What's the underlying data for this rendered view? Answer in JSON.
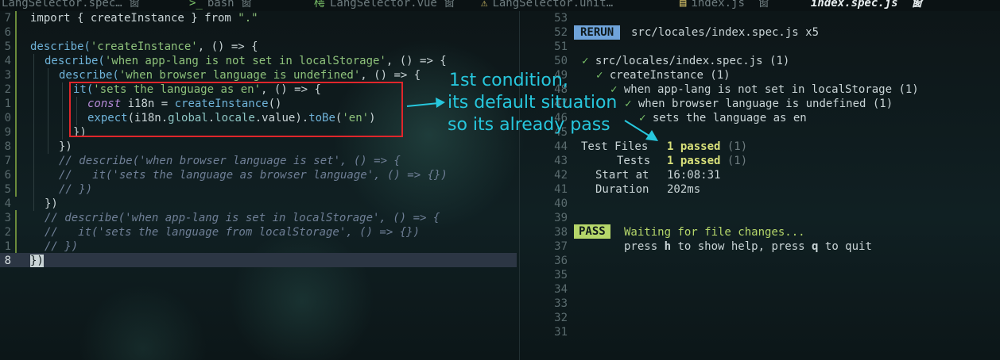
{
  "tabs": [
    {
      "icon": "",
      "label": "LangSelector.spec…",
      "tail": " 窗"
    },
    {
      "icon": ">_",
      "label": "bash",
      "tail": " 窗"
    },
    {
      "icon": "樗",
      "label": "LangSelector.vue",
      "tail": " 窗"
    },
    {
      "icon": "⚠",
      "label": "LangSelector.unit…",
      "tail": ""
    },
    {
      "icon": "▤",
      "label": "index.js",
      "tail": "  窗"
    },
    {
      "icon": "",
      "label": "index.spec.js",
      "tail": "  窗"
    }
  ],
  "editor": {
    "gutter": [
      "7",
      "6",
      "5",
      "4",
      "3",
      "2",
      "1",
      "0",
      "9",
      "8",
      "7",
      "6",
      "5",
      "4",
      "3",
      "2",
      "1",
      "8"
    ],
    "line1": {
      "a": "import { createInstance } from ",
      "b": "\".\""
    },
    "line3": {
      "a": "describe(",
      "b": "'createInstance'",
      "c": ", () => {"
    },
    "line4": {
      "a": "describe(",
      "b": "'when app-lang is not set in localStorage'",
      "c": ", () => {"
    },
    "line5": {
      "a": "describe(",
      "b": "'when browser language is undefined'",
      "c": ", () => {"
    },
    "line6": {
      "a": "it(",
      "b": "'sets the language as en'",
      "c": ", () => {"
    },
    "line7": {
      "a": "const",
      "b": " i18n = ",
      "c": "createInstance",
      "d": "()"
    },
    "line8": {
      "a": "expect",
      "b": "(i18n.",
      "c": "global",
      "d": ".",
      "e": "locale",
      "f": ".value).",
      "g": "toBe",
      "h": "(",
      "i": "'en'",
      "j": ")"
    },
    "line9": "})",
    "line10": "})",
    "line11": "// describe('when browser language is set', () => {",
    "line12": "//   it('sets the language as browser language', () => {})",
    "line13": "// })",
    "line14": "})",
    "line15": "// describe('when app-lang is set in localStorage', () => {",
    "line16": "//   it('sets the language from localStorage', () => {})",
    "line17": "// })",
    "line18": "})"
  },
  "terminal": {
    "gutter": [
      "53",
      "52",
      "51",
      "50",
      "49",
      "48",
      "47",
      "46",
      "45",
      "44",
      "43",
      "42",
      "41",
      "40",
      "39",
      "38",
      "37",
      "36",
      "35",
      "34",
      "33",
      "32",
      "31"
    ],
    "rerun_badge": "RERUN",
    "rerun_text": "src/locales/index.spec.js x5",
    "tree": [
      {
        "check": "✓",
        "text": "src/locales/index.spec.js (1)"
      },
      {
        "check": "✓",
        "text": "createInstance (1)"
      },
      {
        "check": "✓",
        "text": "when app-lang is not set in localStorage (1)"
      },
      {
        "check": "✓",
        "text": "when browser language is undefined (1)"
      },
      {
        "check": "✓",
        "text": "sets the language as en"
      }
    ],
    "test_files_label": "Test Files",
    "test_files_value": "1 passed",
    "test_files_count": "(1)",
    "tests_label": "Tests",
    "tests_value": "1 passed",
    "tests_count": "(1)",
    "start_label": "Start at",
    "start_value": "16:08:31",
    "duration_label": "Duration",
    "duration_value": "202ms",
    "pass_badge": "PASS",
    "waiting_text": "Waiting for file changes...",
    "help": {
      "a": "press ",
      "b": "h",
      "c": " to show help, press ",
      "d": "q",
      "e": " to quit"
    }
  },
  "annotation": {
    "line1": "1st condition,",
    "line2": "its default situation",
    "line3": "so its already pass",
    "color": "#27c7dd",
    "box_color": "#e0262b"
  }
}
